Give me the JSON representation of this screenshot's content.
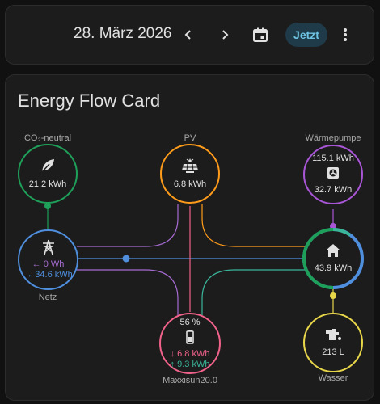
{
  "header": {
    "date": "28. März 2026",
    "now_label": "Jetzt"
  },
  "card": {
    "title": "Energy Flow Card"
  },
  "nodes": {
    "co2": {
      "label": "CO₂-neutral",
      "value": "21.2 kWh",
      "color": "#1ea05a"
    },
    "pv": {
      "label": "PV",
      "value": "6.8 kWh",
      "color": "#ff9b1a"
    },
    "heatpump": {
      "label": "Wärmepumpe",
      "value1": "115.1 kWh",
      "value2": "32.7 kWh",
      "color": "#a855d6"
    },
    "grid": {
      "label": "Netz",
      "in": "0 Wh",
      "out": "34.6 kWh",
      "color": "#4f8fde"
    },
    "home": {
      "value": "43.9 kWh"
    },
    "battery": {
      "label": "Maxxisun20.0",
      "percent": "56 %",
      "in": "6.8 kWh",
      "out": "9.3 kWh",
      "color": "#f0628a"
    },
    "water": {
      "label": "Wasser",
      "value": "213 L",
      "color": "#e8d64a"
    }
  },
  "arrows": {
    "in": "←",
    "out": "→",
    "down": "↓",
    "up": "↑"
  }
}
